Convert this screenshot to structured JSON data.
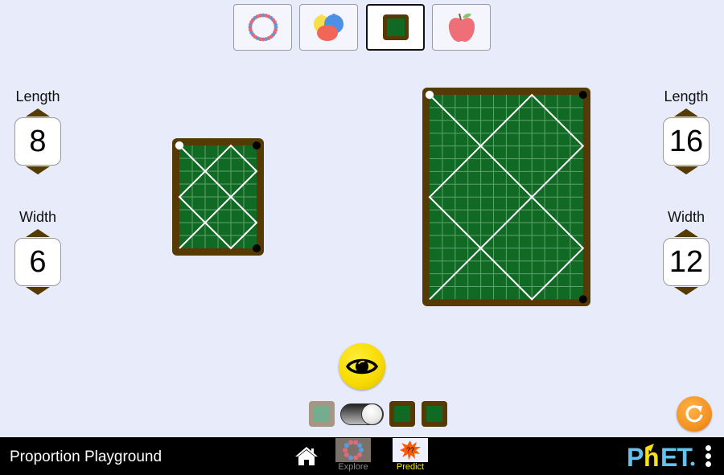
{
  "app": {
    "title": "Proportion Playground"
  },
  "scene_selector": {
    "options": [
      {
        "id": "necklace",
        "icon": "necklace-icon",
        "selected": false
      },
      {
        "id": "balloons",
        "icon": "balloons-icon",
        "selected": false
      },
      {
        "id": "billiards",
        "icon": "billiards-table-icon",
        "selected": true
      },
      {
        "id": "apples",
        "icon": "apple-icon",
        "selected": false
      }
    ]
  },
  "left_table": {
    "length_label": "Length",
    "length_value": "8",
    "width_label": "Width",
    "width_value": "6",
    "length": 8,
    "width": 6
  },
  "right_table": {
    "length_label": "Length",
    "length_value": "16",
    "width_label": "Width",
    "width_value": "12",
    "length": 16,
    "width": 12
  },
  "colors": {
    "rail": "#553a06",
    "felt": "#116a24",
    "grid": "#5fa06d",
    "path": "#ffffff",
    "pocket": "#000000",
    "cue_ball": "#ffffff",
    "spinner_arrow": "#553b00",
    "eye_button": "#f7d900",
    "reset_button": "#f59322",
    "predict_label": "#ffe800",
    "explore_label": "#8a8a8a"
  },
  "controls": {
    "reveal_button": "eye-icon",
    "toggle_state": "right"
  },
  "navbar": {
    "tabs": [
      {
        "label": "Explore",
        "selected": false
      },
      {
        "label": "Predict",
        "selected": true
      }
    ],
    "logo_text": "PhET"
  }
}
